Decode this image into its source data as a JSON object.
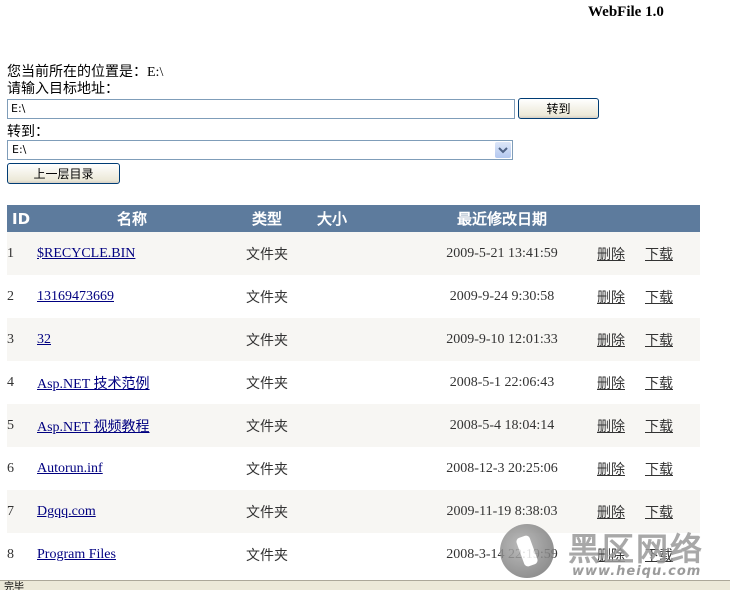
{
  "app": {
    "title": "WebFile 1.0"
  },
  "location": {
    "label": "您当前所在的位置是：",
    "path": "E:\\"
  },
  "target": {
    "label": "请输入目标地址：",
    "value": "E:\\",
    "go_label": "转到"
  },
  "jump": {
    "label": "转到：",
    "selected": "E:\\"
  },
  "up_button": {
    "label": "上一层目录"
  },
  "table": {
    "headers": {
      "id": "ID",
      "name": "名称",
      "type": "类型",
      "size": "大小",
      "modified": "最近修改日期"
    },
    "rows": [
      {
        "id": "1",
        "name": "$RECYCLE.BIN",
        "type": "文件夹",
        "size": "",
        "modified": "2009-5-21 13:41:59",
        "delete": "删除",
        "download": "下载"
      },
      {
        "id": "2",
        "name": "13169473669",
        "type": "文件夹",
        "size": "",
        "modified": "2009-9-24 9:30:58",
        "delete": "删除",
        "download": "下载"
      },
      {
        "id": "3",
        "name": "32",
        "type": "文件夹",
        "size": "",
        "modified": "2009-9-10 12:01:33",
        "delete": "删除",
        "download": "下载"
      },
      {
        "id": "4",
        "name": "Asp.NET 技术范例",
        "type": "文件夹",
        "size": "",
        "modified": "2008-5-1 22:06:43",
        "delete": "删除",
        "download": "下载"
      },
      {
        "id": "5",
        "name": "Asp.NET 视频教程",
        "type": "文件夹",
        "size": "",
        "modified": "2008-5-4 18:04:14",
        "delete": "删除",
        "download": "下载"
      },
      {
        "id": "6",
        "name": "Autorun.inf",
        "type": "文件夹",
        "size": "",
        "modified": "2008-12-3 20:25:06",
        "delete": "删除",
        "download": "下载"
      },
      {
        "id": "7",
        "name": "Dgqq.com",
        "type": "文件夹",
        "size": "",
        "modified": "2009-11-19 8:38:03",
        "delete": "删除",
        "download": "下载"
      },
      {
        "id": "8",
        "name": "Program Files",
        "type": "文件夹",
        "size": "",
        "modified": "2008-3-14 22:19:59",
        "delete": "删除",
        "download": "下载"
      }
    ]
  },
  "status": {
    "text": "完毕"
  },
  "watermark": {
    "text": "黑区网络",
    "url": "www.heiqu.com"
  },
  "colors": {
    "header_bg": "#5d7b9d",
    "odd_row": "#f7f6f3",
    "link": "#000080",
    "date": "#284775"
  }
}
